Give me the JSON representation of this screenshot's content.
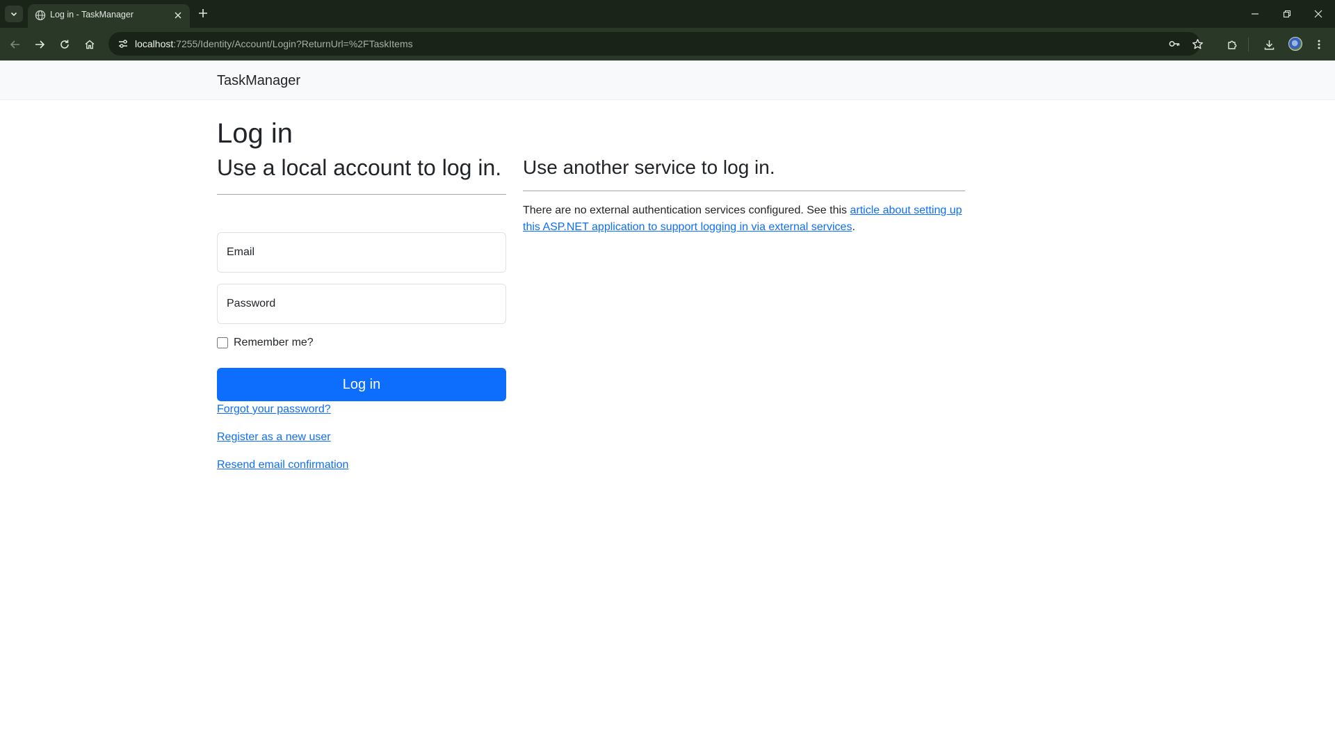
{
  "browser": {
    "tab_title": "Log in - TaskManager",
    "url_host": "localhost",
    "url_path": ":7255/Identity/Account/Login?ReturnUrl=%2FTaskItems"
  },
  "navbar": {
    "brand": "TaskManager"
  },
  "page": {
    "title": "Log in",
    "local": {
      "heading": "Use a local account to log in.",
      "email_placeholder": "Email",
      "password_placeholder": "Password",
      "remember_label": "Remember me?",
      "login_button": "Log in",
      "forgot_link": "Forgot your password?",
      "register_link": "Register as a new user",
      "resend_link": "Resend email confirmation"
    },
    "external": {
      "heading": "Use another service to log in.",
      "text_before": "There are no external authentication services configured. See this ",
      "link_text": "article about setting up this ASP.NET application to support logging in via external services",
      "text_after": "."
    }
  },
  "colors": {
    "primary": "#0d6efd",
    "navbar_bg": "#f8f9fa",
    "chrome_frame": "#1b2419",
    "chrome_toolbar": "#2a3828"
  },
  "icons": {
    "tab_list": "chevron-down-icon",
    "favicon": "globe-icon",
    "tab_close": "close-icon",
    "new_tab": "plus-icon",
    "back": "arrow-left-icon",
    "forward": "arrow-right-icon",
    "reload": "reload-icon",
    "home": "home-icon",
    "site_info": "tune-icon",
    "passwords": "key-icon",
    "bookmark": "star-icon",
    "extensions": "puzzle-icon",
    "downloads": "download-icon",
    "menu": "kebab-menu-icon"
  }
}
